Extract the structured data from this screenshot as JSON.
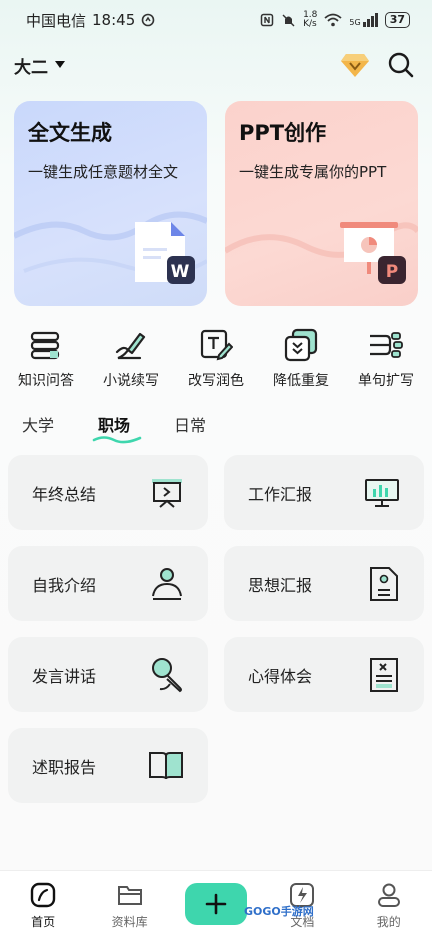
{
  "status_bar": {
    "carrier": "中国电信",
    "time": "18:45",
    "net_speed_top": "1.8",
    "net_speed_bottom": "K/s",
    "signal_label": "5G",
    "battery": "37"
  },
  "header": {
    "grade": "大二",
    "icons": [
      "dropdown-icon",
      "vip-diamond-icon",
      "search-icon"
    ]
  },
  "feature_cards": [
    {
      "title": "全文生成",
      "subtitle": "一键生成任意题材全文",
      "badge": "W",
      "accent": "#2c3250"
    },
    {
      "title": "PPT创作",
      "subtitle": "一键生成专属你的PPT",
      "badge": "P",
      "accent": "#3a2530"
    }
  ],
  "tools": [
    {
      "label": "知识问答",
      "icon": "books-icon"
    },
    {
      "label": "小说续写",
      "icon": "pen-icon"
    },
    {
      "label": "改写润色",
      "icon": "text-edit-icon"
    },
    {
      "label": "降低重复",
      "icon": "reduce-duplicate-icon"
    },
    {
      "label": "单句扩写",
      "icon": "expand-icon"
    }
  ],
  "tabs": [
    {
      "label": "大学",
      "active": false
    },
    {
      "label": "职场",
      "active": true
    },
    {
      "label": "日常",
      "active": false
    }
  ],
  "templates": [
    {
      "label": "年终总结",
      "icon": "presentation-icon"
    },
    {
      "label": "工作汇报",
      "icon": "chart-board-icon"
    },
    {
      "label": "自我介绍",
      "icon": "person-icon"
    },
    {
      "label": "思想汇报",
      "icon": "document-icon"
    },
    {
      "label": "发言讲话",
      "icon": "microphone-icon"
    },
    {
      "label": "心得体会",
      "icon": "note-icon"
    },
    {
      "label": "述职报告",
      "icon": "book-icon"
    }
  ],
  "bottom_nav": [
    {
      "label": "首页",
      "active": true
    },
    {
      "label": "资料库",
      "active": false
    },
    {
      "label": "",
      "active": false
    },
    {
      "label": "文档",
      "active": false
    },
    {
      "label": "我的",
      "active": false
    }
  ],
  "watermark": "GOGO手游网",
  "colors": {
    "accent_green": "#3ed6ad",
    "card_blue": "#d2defb",
    "card_red": "#fbd4ce",
    "tile_bg": "#f1f2f2"
  }
}
